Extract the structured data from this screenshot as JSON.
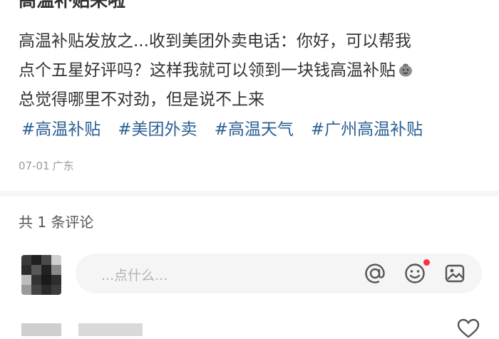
{
  "post": {
    "title": "高温补贴来啦",
    "body_lines": [
      "高温补贴发放之...收到美团外卖电话：你好，可以帮我",
      "点个五星好评吗？这样我就可以领到一块钱高温补贴",
      "总觉得哪里不对劲，但是说不上来"
    ],
    "emoji_icon": "money-bag-icon",
    "tags": [
      "#高温补贴",
      "#美团外卖",
      "#高温天气",
      "#广州高温补贴"
    ],
    "date": "07-01",
    "location": "广东"
  },
  "comments": {
    "count_text": "共 1 条评论",
    "input_placeholder": "...点什么...",
    "icons": [
      "at-icon",
      "emoji-icon",
      "image-icon",
      "heart-icon"
    ]
  },
  "colors": {
    "tag": "#2c5f93",
    "notification_dot": "#ff3040",
    "input_bg": "#f5f5f5",
    "muted_text": "#9a9a9a"
  }
}
